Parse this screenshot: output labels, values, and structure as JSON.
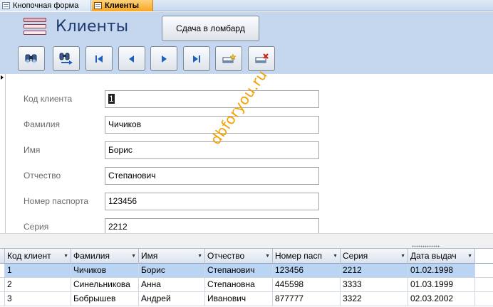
{
  "tabs": [
    {
      "label": "Кнопочная форма"
    },
    {
      "label": "Клиенты"
    }
  ],
  "header": {
    "title": "Клиенты",
    "pawn_button": "Сдача в ломбард",
    "nav_buttons": [
      "find-icon",
      "find-next-icon",
      "first-record-icon",
      "previous-record-icon",
      "next-record-icon",
      "last-record-icon",
      "new-record-icon",
      "delete-record-icon"
    ]
  },
  "form": {
    "fields": [
      {
        "label": "Код клиента",
        "value": "1"
      },
      {
        "label": "Фамилия",
        "value": "Чичиков"
      },
      {
        "label": "Имя",
        "value": "Борис"
      },
      {
        "label": "Отчество",
        "value": "Степанович"
      },
      {
        "label": "Номер паспорта",
        "value": "123456"
      },
      {
        "label": "Серия",
        "value": "2212"
      }
    ],
    "watermark": "dbforyou.ru"
  },
  "datasheet": {
    "columns": [
      "Код клиент",
      "Фамилия",
      "Имя",
      "Отчество",
      "Номер пасп",
      "Серия",
      "Дата выдач"
    ],
    "rows": [
      [
        "1",
        "Чичиков",
        "Борис",
        "Степанович",
        "123456",
        "2212",
        "01.02.1998"
      ],
      [
        "2",
        "Синельникова",
        "Анна",
        "Степановна",
        "445598",
        "3333",
        "01.03.1999"
      ],
      [
        "3",
        "Бобрышев",
        "Андрей",
        "Иванович",
        "877777",
        "3322",
        "02.03.2002"
      ]
    ]
  },
  "colors": {
    "header_bg": "#c5d6ef",
    "active_tab": "#f5a623",
    "title_color": "#1f3b6f",
    "selected_row": "#b9d5f3",
    "watermark": "#f5a000"
  }
}
